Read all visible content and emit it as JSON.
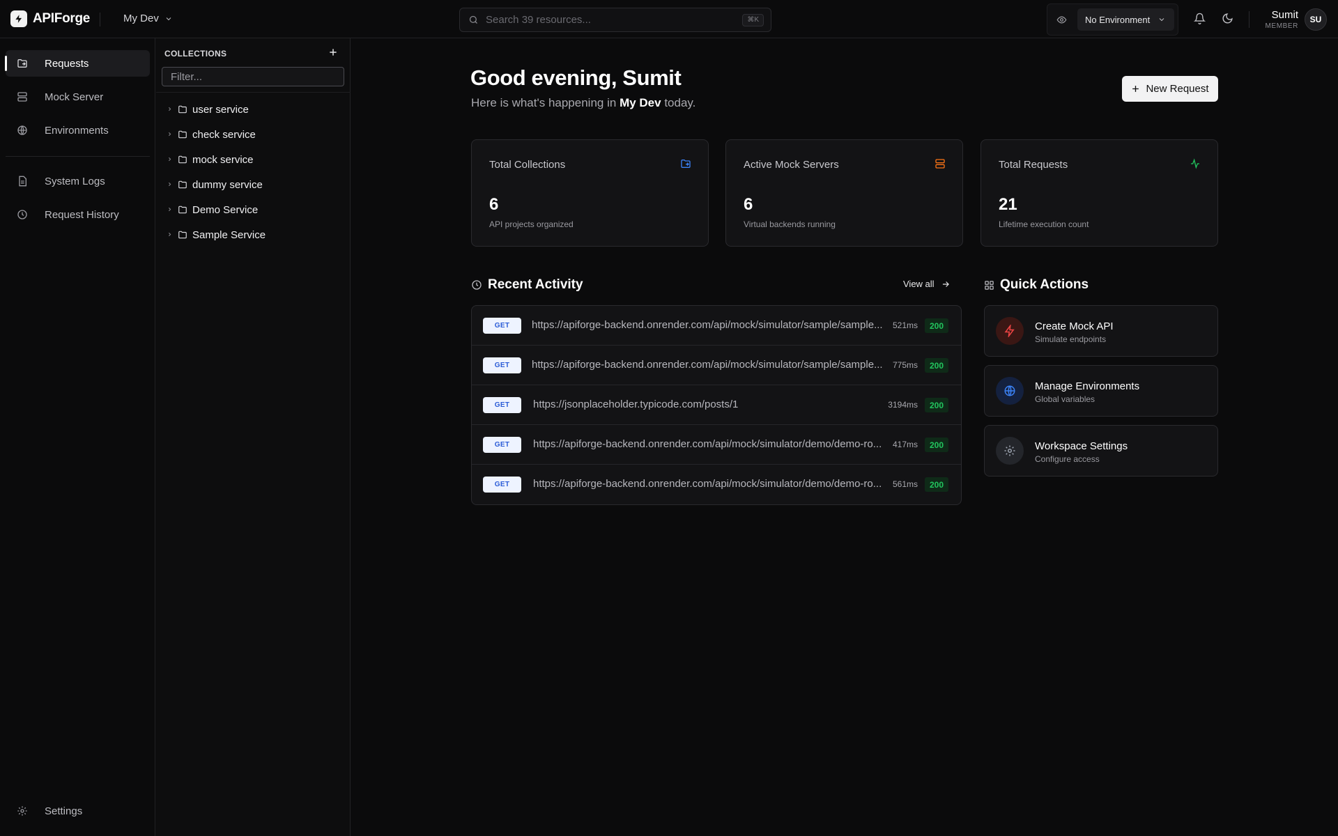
{
  "app": {
    "name": "APIForge",
    "workspace": "My Dev"
  },
  "search": {
    "placeholder": "Search 39 resources...",
    "shortcut": "⌘K"
  },
  "environment": {
    "selected": "No Environment"
  },
  "user": {
    "name": "Sumit",
    "role": "MEMBER",
    "initials": "SU"
  },
  "nav": {
    "items": [
      {
        "label": "Requests",
        "icon": "folder-arrow-icon",
        "active": true
      },
      {
        "label": "Mock Server",
        "icon": "server-icon"
      },
      {
        "label": "Environments",
        "icon": "globe-icon"
      },
      {
        "label": "System Logs",
        "icon": "document-icon"
      },
      {
        "label": "Request History",
        "icon": "clock-icon"
      }
    ],
    "settings": "Settings"
  },
  "collections": {
    "title": "COLLECTIONS",
    "filter_placeholder": "Filter...",
    "items": [
      "user service",
      "check service",
      "mock service",
      "dummy service",
      "Demo Service",
      "Sample Service"
    ]
  },
  "main": {
    "greeting": "Good evening, Sumit",
    "sub_prefix": "Here is what's happening in",
    "sub_workspace": "My Dev",
    "sub_suffix": "today.",
    "new_request": "New Request"
  },
  "stats": [
    {
      "title": "Total Collections",
      "value": "6",
      "desc": "API projects organized",
      "icon": "folder-icon",
      "color": "#3b82f6"
    },
    {
      "title": "Active Mock Servers",
      "value": "6",
      "desc": "Virtual backends running",
      "icon": "server-icon",
      "color": "#f97316"
    },
    {
      "title": "Total Requests",
      "value": "21",
      "desc": "Lifetime execution count",
      "icon": "activity-icon",
      "color": "#22c55e"
    }
  ],
  "activity": {
    "title": "Recent Activity",
    "view_all": "View all",
    "rows": [
      {
        "method": "GET",
        "url": "https://apiforge-backend.onrender.com/api/mock/simulator/sample/sample...",
        "ms": "521ms",
        "status": "200"
      },
      {
        "method": "GET",
        "url": "https://apiforge-backend.onrender.com/api/mock/simulator/sample/sample...",
        "ms": "775ms",
        "status": "200"
      },
      {
        "method": "GET",
        "url": "https://jsonplaceholder.typicode.com/posts/1",
        "ms": "3194ms",
        "status": "200"
      },
      {
        "method": "GET",
        "url": "https://apiforge-backend.onrender.com/api/mock/simulator/demo/demo-ro...",
        "ms": "417ms",
        "status": "200"
      },
      {
        "method": "GET",
        "url": "https://apiforge-backend.onrender.com/api/mock/simulator/demo/demo-ro...",
        "ms": "561ms",
        "status": "200"
      }
    ]
  },
  "quick_actions": {
    "title": "Quick Actions",
    "items": [
      {
        "title": "Create Mock API",
        "subtitle": "Simulate endpoints",
        "icon": "bolt-icon",
        "color": "#ef4444"
      },
      {
        "title": "Manage Environments",
        "subtitle": "Global variables",
        "icon": "globe-icon",
        "color": "#3b82f6"
      },
      {
        "title": "Workspace Settings",
        "subtitle": "Configure access",
        "icon": "gear-icon",
        "color": "#9ca3af"
      }
    ]
  }
}
